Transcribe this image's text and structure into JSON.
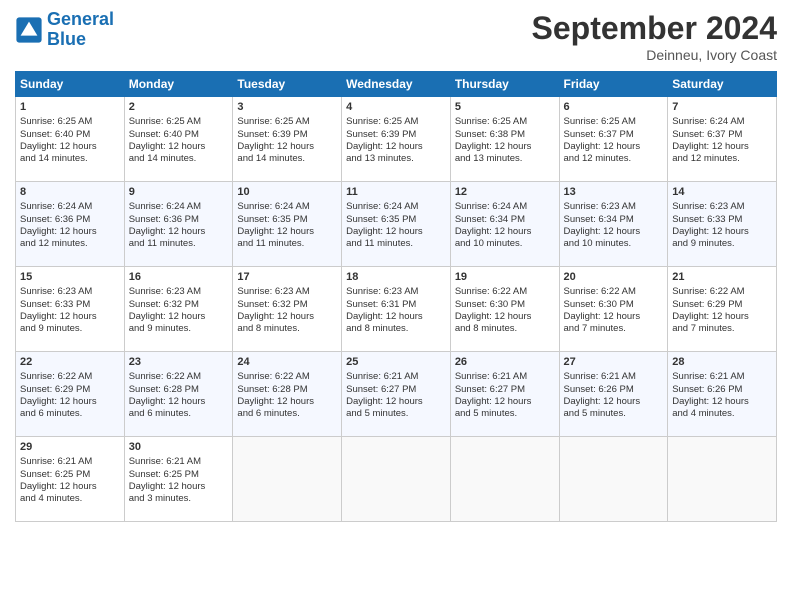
{
  "header": {
    "logo_line1": "General",
    "logo_line2": "Blue",
    "month": "September 2024",
    "location": "Deinneu, Ivory Coast"
  },
  "weekdays": [
    "Sunday",
    "Monday",
    "Tuesday",
    "Wednesday",
    "Thursday",
    "Friday",
    "Saturday"
  ],
  "weeks": [
    [
      {
        "day": "1",
        "lines": [
          "Sunrise: 6:25 AM",
          "Sunset: 6:40 PM",
          "Daylight: 12 hours",
          "and 14 minutes."
        ]
      },
      {
        "day": "2",
        "lines": [
          "Sunrise: 6:25 AM",
          "Sunset: 6:40 PM",
          "Daylight: 12 hours",
          "and 14 minutes."
        ]
      },
      {
        "day": "3",
        "lines": [
          "Sunrise: 6:25 AM",
          "Sunset: 6:39 PM",
          "Daylight: 12 hours",
          "and 14 minutes."
        ]
      },
      {
        "day": "4",
        "lines": [
          "Sunrise: 6:25 AM",
          "Sunset: 6:39 PM",
          "Daylight: 12 hours",
          "and 13 minutes."
        ]
      },
      {
        "day": "5",
        "lines": [
          "Sunrise: 6:25 AM",
          "Sunset: 6:38 PM",
          "Daylight: 12 hours",
          "and 13 minutes."
        ]
      },
      {
        "day": "6",
        "lines": [
          "Sunrise: 6:25 AM",
          "Sunset: 6:37 PM",
          "Daylight: 12 hours",
          "and 12 minutes."
        ]
      },
      {
        "day": "7",
        "lines": [
          "Sunrise: 6:24 AM",
          "Sunset: 6:37 PM",
          "Daylight: 12 hours",
          "and 12 minutes."
        ]
      }
    ],
    [
      {
        "day": "8",
        "lines": [
          "Sunrise: 6:24 AM",
          "Sunset: 6:36 PM",
          "Daylight: 12 hours",
          "and 12 minutes."
        ]
      },
      {
        "day": "9",
        "lines": [
          "Sunrise: 6:24 AM",
          "Sunset: 6:36 PM",
          "Daylight: 12 hours",
          "and 11 minutes."
        ]
      },
      {
        "day": "10",
        "lines": [
          "Sunrise: 6:24 AM",
          "Sunset: 6:35 PM",
          "Daylight: 12 hours",
          "and 11 minutes."
        ]
      },
      {
        "day": "11",
        "lines": [
          "Sunrise: 6:24 AM",
          "Sunset: 6:35 PM",
          "Daylight: 12 hours",
          "and 11 minutes."
        ]
      },
      {
        "day": "12",
        "lines": [
          "Sunrise: 6:24 AM",
          "Sunset: 6:34 PM",
          "Daylight: 12 hours",
          "and 10 minutes."
        ]
      },
      {
        "day": "13",
        "lines": [
          "Sunrise: 6:23 AM",
          "Sunset: 6:34 PM",
          "Daylight: 12 hours",
          "and 10 minutes."
        ]
      },
      {
        "day": "14",
        "lines": [
          "Sunrise: 6:23 AM",
          "Sunset: 6:33 PM",
          "Daylight: 12 hours",
          "and 9 minutes."
        ]
      }
    ],
    [
      {
        "day": "15",
        "lines": [
          "Sunrise: 6:23 AM",
          "Sunset: 6:33 PM",
          "Daylight: 12 hours",
          "and 9 minutes."
        ]
      },
      {
        "day": "16",
        "lines": [
          "Sunrise: 6:23 AM",
          "Sunset: 6:32 PM",
          "Daylight: 12 hours",
          "and 9 minutes."
        ]
      },
      {
        "day": "17",
        "lines": [
          "Sunrise: 6:23 AM",
          "Sunset: 6:32 PM",
          "Daylight: 12 hours",
          "and 8 minutes."
        ]
      },
      {
        "day": "18",
        "lines": [
          "Sunrise: 6:23 AM",
          "Sunset: 6:31 PM",
          "Daylight: 12 hours",
          "and 8 minutes."
        ]
      },
      {
        "day": "19",
        "lines": [
          "Sunrise: 6:22 AM",
          "Sunset: 6:30 PM",
          "Daylight: 12 hours",
          "and 8 minutes."
        ]
      },
      {
        "day": "20",
        "lines": [
          "Sunrise: 6:22 AM",
          "Sunset: 6:30 PM",
          "Daylight: 12 hours",
          "and 7 minutes."
        ]
      },
      {
        "day": "21",
        "lines": [
          "Sunrise: 6:22 AM",
          "Sunset: 6:29 PM",
          "Daylight: 12 hours",
          "and 7 minutes."
        ]
      }
    ],
    [
      {
        "day": "22",
        "lines": [
          "Sunrise: 6:22 AM",
          "Sunset: 6:29 PM",
          "Daylight: 12 hours",
          "and 6 minutes."
        ]
      },
      {
        "day": "23",
        "lines": [
          "Sunrise: 6:22 AM",
          "Sunset: 6:28 PM",
          "Daylight: 12 hours",
          "and 6 minutes."
        ]
      },
      {
        "day": "24",
        "lines": [
          "Sunrise: 6:22 AM",
          "Sunset: 6:28 PM",
          "Daylight: 12 hours",
          "and 6 minutes."
        ]
      },
      {
        "day": "25",
        "lines": [
          "Sunrise: 6:21 AM",
          "Sunset: 6:27 PM",
          "Daylight: 12 hours",
          "and 5 minutes."
        ]
      },
      {
        "day": "26",
        "lines": [
          "Sunrise: 6:21 AM",
          "Sunset: 6:27 PM",
          "Daylight: 12 hours",
          "and 5 minutes."
        ]
      },
      {
        "day": "27",
        "lines": [
          "Sunrise: 6:21 AM",
          "Sunset: 6:26 PM",
          "Daylight: 12 hours",
          "and 5 minutes."
        ]
      },
      {
        "day": "28",
        "lines": [
          "Sunrise: 6:21 AM",
          "Sunset: 6:26 PM",
          "Daylight: 12 hours",
          "and 4 minutes."
        ]
      }
    ],
    [
      {
        "day": "29",
        "lines": [
          "Sunrise: 6:21 AM",
          "Sunset: 6:25 PM",
          "Daylight: 12 hours",
          "and 4 minutes."
        ]
      },
      {
        "day": "30",
        "lines": [
          "Sunrise: 6:21 AM",
          "Sunset: 6:25 PM",
          "Daylight: 12 hours",
          "and 3 minutes."
        ]
      },
      {
        "day": "",
        "lines": []
      },
      {
        "day": "",
        "lines": []
      },
      {
        "day": "",
        "lines": []
      },
      {
        "day": "",
        "lines": []
      },
      {
        "day": "",
        "lines": []
      }
    ]
  ]
}
